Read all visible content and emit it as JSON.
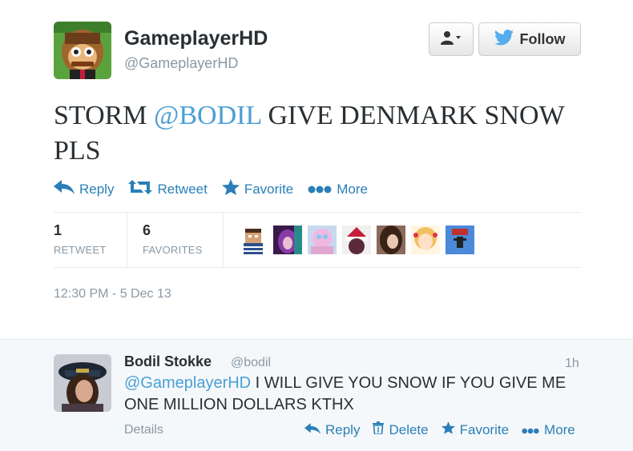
{
  "tweet": {
    "display_name": "GameplayerHD",
    "handle": "@GameplayerHD",
    "text_prefix": "STORM ",
    "mention": "@BODIL",
    "text_suffix": " GIVE DENMARK SNOW PLS",
    "timestamp": "12:30 PM - 5 Dec 13"
  },
  "header": {
    "follow_label": "Follow"
  },
  "actions": {
    "reply": "Reply",
    "retweet": "Retweet",
    "favorite": "Favorite",
    "more": "More"
  },
  "stats": {
    "retweets": "1",
    "retweets_label": "RETWEET",
    "favorites": "6",
    "favorites_label": "FAVORITES"
  },
  "favoriters": [
    {
      "icon": "minecraft-avatar"
    },
    {
      "icon": "purple-hair-avatar"
    },
    {
      "icon": "pastel-avatar"
    },
    {
      "icon": "santa-hat-avatar"
    },
    {
      "icon": "girl-avatar"
    },
    {
      "icon": "anime-girl-avatar"
    },
    {
      "icon": "blue-avatar"
    }
  ],
  "reply": {
    "display_name": "Bodil Stokke",
    "handle": "@bodil",
    "time": "1h",
    "mention": "@GameplayerHD",
    "text": " I WILL GIVE YOU SNOW IF YOU GIVE ME ONE MILLION DOLLARS KTHX",
    "details_label": "Details",
    "actions": {
      "reply": "Reply",
      "delete": "Delete",
      "favorite": "Favorite",
      "more": "More"
    }
  },
  "colors": {
    "link": "#2a7fb8",
    "mention": "#4a9fd5",
    "twitter_blue": "#55acee",
    "muted": "#8899a6"
  }
}
